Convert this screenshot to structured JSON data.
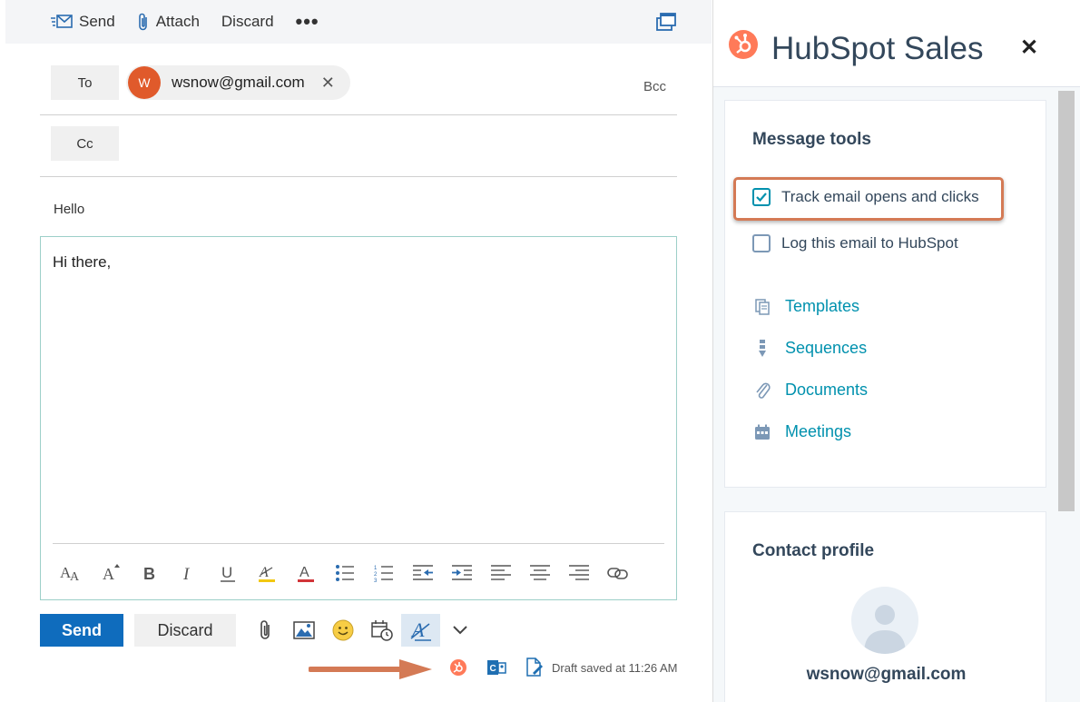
{
  "toolbar": {
    "send_label": "Send",
    "attach_label": "Attach",
    "discard_label": "Discard",
    "more_label": "•••"
  },
  "recipients": {
    "to_label": "To",
    "cc_label": "Cc",
    "bcc_label": "Bcc",
    "to_chip": {
      "initial": "W",
      "email": "wsnow@gmail.com",
      "remove_glyph": "✕"
    }
  },
  "subject": "Hello",
  "body": "Hi there,",
  "format_toolbar": [
    "font-size-icon",
    "grow-font-icon",
    "bold-icon",
    "italic-icon",
    "underline-icon",
    "highlight-icon",
    "font-color-icon",
    "bullets-icon",
    "numbering-icon",
    "decrease-indent-icon",
    "increase-indent-icon",
    "align-left-icon",
    "align-center-icon",
    "align-right-icon",
    "link-icon"
  ],
  "actions": {
    "send_label": "Send",
    "discard_label": "Discard"
  },
  "status": {
    "draft_text": "Draft saved at 11:26 AM"
  },
  "hubspot": {
    "title": "HubSpot Sales",
    "close_glyph": "✕",
    "message_tools": {
      "title": "Message tools",
      "track_label": "Track email opens and clicks",
      "track_checked": true,
      "log_label": "Log this email to HubSpot",
      "log_checked": false,
      "tools": [
        "Templates",
        "Sequences",
        "Documents",
        "Meetings"
      ]
    },
    "contact_profile": {
      "title": "Contact profile",
      "email": "wsnow@gmail.com"
    }
  },
  "colors": {
    "send_blue": "#0f6cbd",
    "hubspot_orange": "#ff7a59",
    "hubspot_teal": "#0091ae",
    "avatar_orange": "#e05a2b",
    "highlight_border": "#d47a55"
  }
}
